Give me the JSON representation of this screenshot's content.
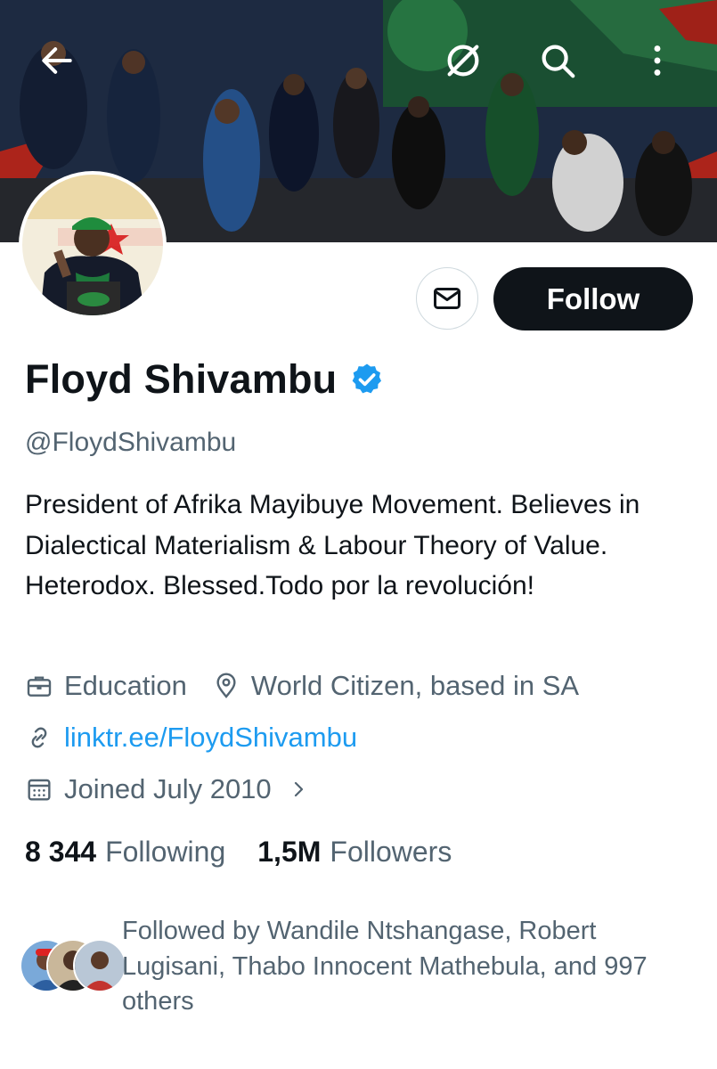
{
  "profile": {
    "name": "Floyd Shivambu",
    "handle": "@FloydShivambu",
    "bio": "President of Afrika Mayibuye Movement. Believes in Dialectical Materialism & Labour Theory of Value. Heterodox. Blessed.Todo por la revolución!",
    "category": "Education",
    "location": "World Citizen, based in SA",
    "website": "linktr.ee/FloydShivambu",
    "joined": "Joined July 2010",
    "following_count": "8 344",
    "following_label": "Following",
    "followers_count": "1,5M",
    "followers_label": "Followers",
    "followed_by": "Followed by Wandile Ntshangase, Robert Lugisani, Thabo Innocent Mathebula, and 997 others",
    "verified": true
  },
  "actions": {
    "follow_label": "Follow"
  },
  "colors": {
    "link": "#1d9bf0",
    "verified": "#1d9bf0",
    "secondary_text": "#536471",
    "follow_button": "#0f1419"
  },
  "icons": [
    "back-arrow-icon",
    "grok-icon",
    "search-icon",
    "more-icon",
    "message-icon",
    "verified-badge-icon",
    "briefcase-icon",
    "location-pin-icon",
    "link-icon",
    "calendar-icon",
    "chevron-right-icon"
  ]
}
